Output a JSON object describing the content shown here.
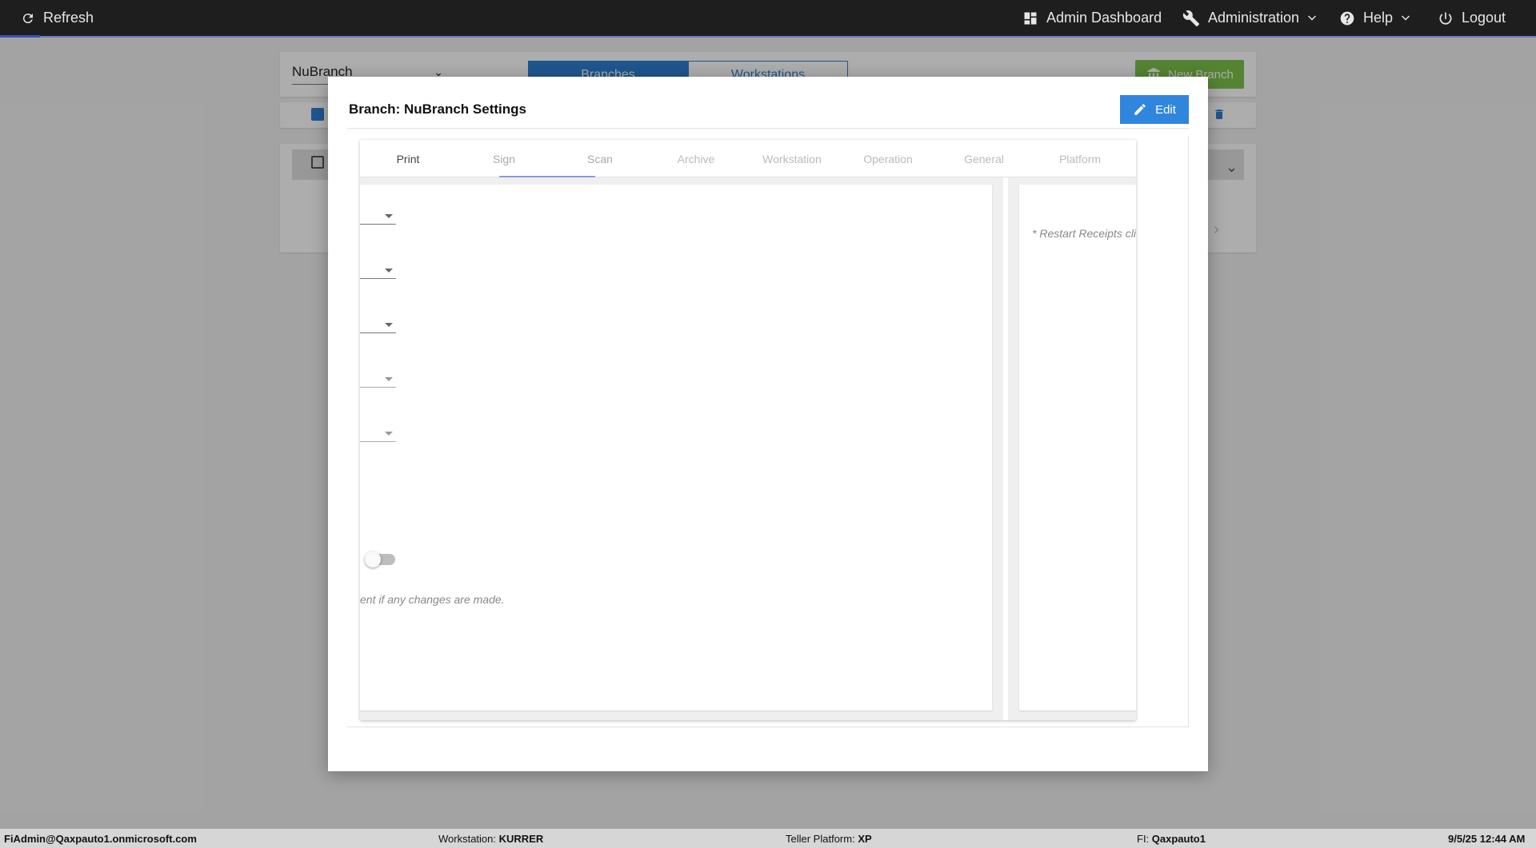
{
  "topbar": {
    "refresh": "Refresh",
    "admin_dashboard": "Admin Dashboard",
    "administration": "Administration",
    "help": "Help",
    "logout": "Logout"
  },
  "background": {
    "branch_select": "NuBranch",
    "toggle": [
      "Branches",
      "Workstations"
    ],
    "new_branch": "New Branch"
  },
  "modal": {
    "title": "Branch: NuBranch Settings",
    "edit_button": "Edit",
    "tabs": [
      "Print",
      "Sign",
      "Scan",
      "Archive",
      "Workstation",
      "Operation",
      "General",
      "Platform"
    ],
    "left_note": "ent if any changes are made.",
    "right_note": "* Restart Receipts cli"
  },
  "statusbar": {
    "user": "FiAdmin@Qaxpauto1.onmicrosoft.com",
    "workstation_label": "Workstation:",
    "workstation_value": "KURRER",
    "platform_label": "Teller Platform:",
    "platform_value": "XP",
    "fi_label": "FI:",
    "fi_value": "Qaxpauto1",
    "datetime": "9/5/25 12:44 AM"
  },
  "colors": {
    "topbar": "#1e1e1e",
    "accent_blue": "#2f86dc",
    "new_branch_green": "#7cc34a"
  }
}
